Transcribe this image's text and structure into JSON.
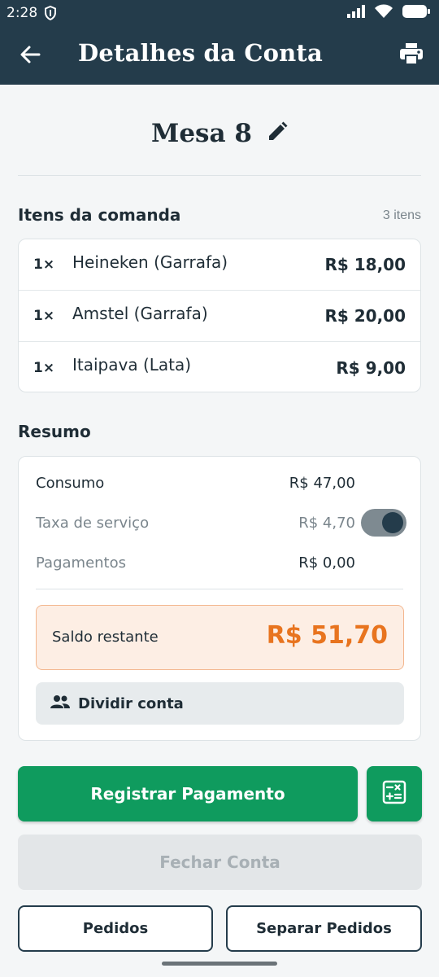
{
  "status_bar": {
    "time": "2:28"
  },
  "app_bar": {
    "title": "Detalhes da Conta"
  },
  "table": {
    "name": "Mesa 8"
  },
  "items_section": {
    "title": "Itens da comanda",
    "count": "3 itens",
    "items": [
      {
        "qty": "1×",
        "name": "Heineken (Garrafa)",
        "price": "R$ 18,00"
      },
      {
        "qty": "1×",
        "name": "Amstel (Garrafa)",
        "price": "R$ 20,00"
      },
      {
        "qty": "1×",
        "name": "Itaipava (Lata)",
        "price": "R$ 9,00"
      }
    ]
  },
  "summary": {
    "title": "Resumo",
    "consumo": {
      "label": "Consumo",
      "value": "R$ 47,00"
    },
    "service_fee": {
      "label": "Taxa de serviço",
      "value": "R$ 4,70",
      "enabled": true
    },
    "payments": {
      "label": "Pagamentos",
      "value": "R$ 0,00"
    },
    "balance": {
      "label": "Saldo restante",
      "value": "R$ 51,70"
    },
    "split_label": "Dividir conta"
  },
  "actions": {
    "register_payment": "Registrar Pagamento",
    "close_account": "Fechar Conta",
    "orders": "Pedidos",
    "split_orders": "Separar Pedidos"
  },
  "colors": {
    "header": "#243c4b",
    "primary": "#0f9b5e",
    "balance_accent": "#e8741f",
    "balance_bg": "#fdeee4"
  },
  "icons": {
    "back": "arrow-left-icon",
    "print": "printer-icon",
    "edit": "pencil-icon",
    "split": "people-icon",
    "calculator": "calculator-icon"
  }
}
